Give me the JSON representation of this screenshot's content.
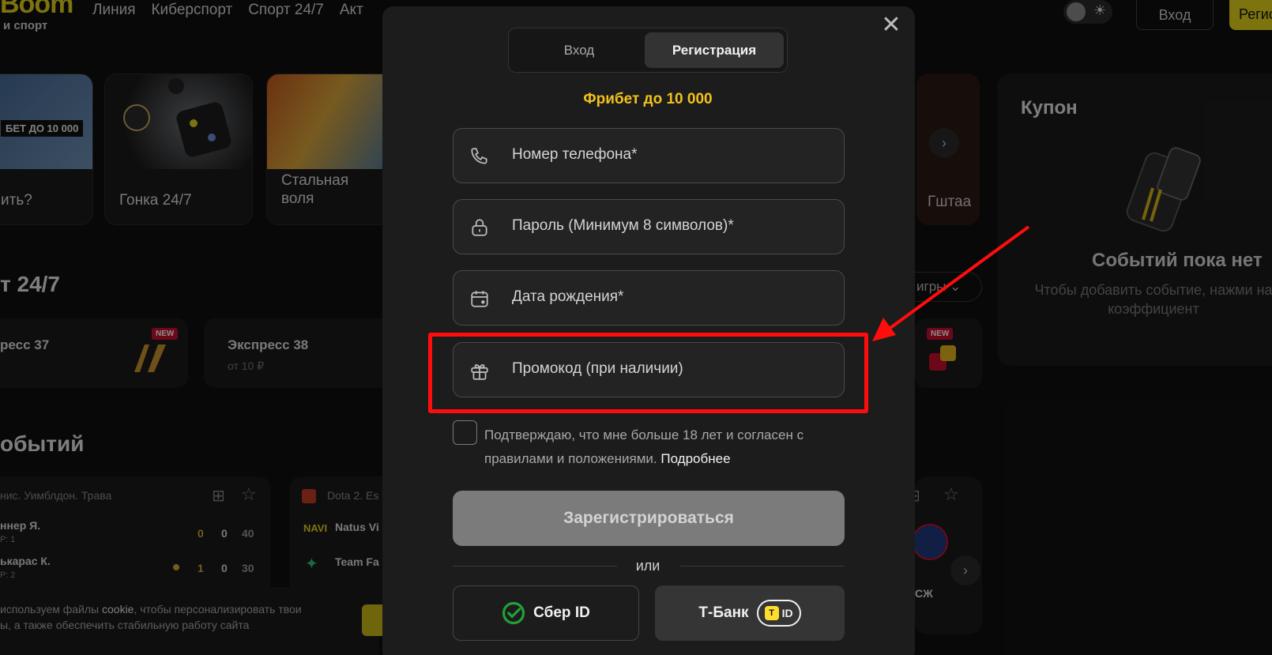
{
  "header": {
    "logo_text": "Boom",
    "logo_subtitle": "и спорт",
    "nav": [
      "Линия",
      "Киберспорт",
      "Спорт 24/7",
      "Акт"
    ],
    "login_label": "Вход",
    "register_label": "Регистрация"
  },
  "tiles": [
    {
      "caption": "ить?",
      "banner_text": "БЕТ ДО 10 000"
    },
    {
      "caption": "Гонка 24/7"
    },
    {
      "caption": "Стальная\nволя"
    }
  ],
  "tile_partial_caption": "Гштаа",
  "coupon": {
    "title": "Купон",
    "empty_title": "Событий пока нет",
    "hint_line1": "Чтобы добавить событие, нажми на",
    "hint_line2": "коэффициент"
  },
  "sections": {
    "sport247": "т 24/7",
    "events": "обытий",
    "games_filter": "игры"
  },
  "express": [
    {
      "title": "ресс 37",
      "badge": "NEW"
    },
    {
      "title": "Экспресс 38",
      "sub": "от 10 ₽"
    }
  ],
  "express_right_badge": "NEW",
  "match1": {
    "league": "нис. Уимблдон. Трава",
    "p1": "ннер Я.",
    "p1_sub": "Р: 1",
    "p2": "ькарас К.",
    "p2_sub": "Р: 2",
    "s1": [
      "0",
      "0",
      "40"
    ],
    "s2": [
      "1",
      "0",
      "30"
    ]
  },
  "match2": {
    "league": "Dota 2. Es",
    "t1": "Natus Vi",
    "t2": "Team Fa"
  },
  "match3_label": "СЖ",
  "cookie": {
    "line1_pre": "используем файлы ",
    "line1_link": "cookie",
    "line1_post": ", чтобы персонализировать твои",
    "line2": "ы, а также обеспечить стабильную работу сайта"
  },
  "modal": {
    "tab_login": "Вход",
    "tab_register": "Регистрация",
    "bonus": "Фрибет до 10 000",
    "fields": [
      {
        "icon": "phone-icon",
        "placeholder": "Номер телефона*"
      },
      {
        "icon": "lock-icon",
        "placeholder": "Пароль (Минимум 8 символов)*"
      },
      {
        "icon": "calendar-icon",
        "placeholder": "Дата рождения*"
      },
      {
        "icon": "gift-icon",
        "placeholder": "Промокод (при наличии)"
      }
    ],
    "agree_text": "Подтверждаю, что мне больше 18 лет и согласен с правилами и положениями.",
    "agree_link": "Подробнее",
    "submit": "Зарегистрироваться",
    "or": "или",
    "sber": "Сбер ID",
    "tbank": "Т-Банк",
    "tbank_id": "ID"
  },
  "colors": {
    "accent_yellow": "#e3d21c",
    "bonus_gold": "#f1c21b",
    "highlight_red": "#ff0d0d",
    "sber_green": "#21a038"
  }
}
